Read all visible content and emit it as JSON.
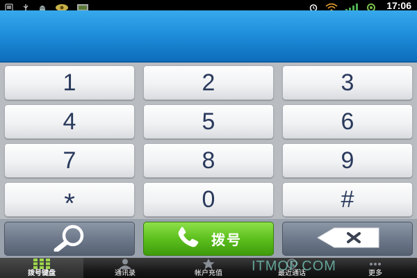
{
  "status_bar": {
    "time": "17:06",
    "icons_left": [
      "sd-card-icon",
      "usb-icon",
      "android-debug-icon",
      "app-notification-icon",
      "image-notification-icon"
    ],
    "icons_right": [
      "alarm-icon",
      "wifi-icon",
      "signal-icon",
      "sync-icon"
    ]
  },
  "display": {
    "number": ""
  },
  "keypad": {
    "keys": [
      "1",
      "2",
      "3",
      "4",
      "5",
      "6",
      "7",
      "8",
      "9",
      "*",
      "0",
      "#"
    ]
  },
  "actions": {
    "search_icon": "search-icon",
    "dial_label": "拨号",
    "dial_icon": "phone-icon",
    "delete_icon": "backspace-icon"
  },
  "tabs": [
    {
      "label": "拨号键盘",
      "icon": "keypad-grid-icon",
      "active": true
    },
    {
      "label": "通讯录",
      "icon": "contact-person-icon",
      "active": false
    },
    {
      "label": "帐户充值",
      "icon": "star-icon",
      "active": false
    },
    {
      "label": "最近通话",
      "icon": "recent-calls-icon",
      "active": false
    },
    {
      "label": "更多",
      "icon": "more-icon",
      "active": false
    }
  ],
  "watermark": "ITMOP.COM",
  "colors": {
    "display_blue": "#1f8fdc",
    "dial_green": "#5cc01d",
    "key_text": "#2a3a5c",
    "watermark": "#78cdbe"
  }
}
